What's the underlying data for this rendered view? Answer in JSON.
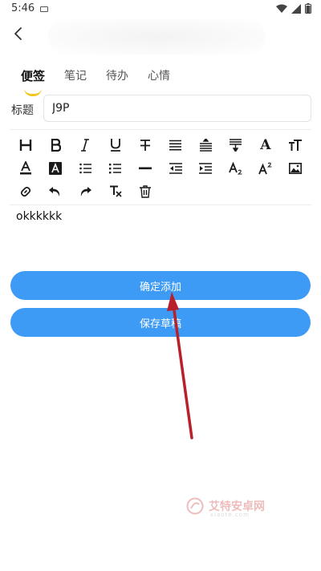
{
  "status_bar": {
    "time": "5:46"
  },
  "tabs": [
    {
      "label": "便签"
    },
    {
      "label": "笔记"
    },
    {
      "label": "待办"
    },
    {
      "label": "心情"
    }
  ],
  "form": {
    "title_label": "标题",
    "title_value": "J9P",
    "content": "okkkkkk"
  },
  "buttons": {
    "confirm_label": "确定添加",
    "draft_label": "保存草稿"
  },
  "toolbar_icons": [
    [
      "heading",
      "bold",
      "italic",
      "underline",
      "strikethrough",
      "align-justify",
      "indent-line-height",
      "move-down",
      "font",
      "text-size"
    ],
    [
      "font-color",
      "highlight",
      "ordered-list",
      "unordered-list",
      "horizontal-rule",
      "outdent",
      "indent",
      "subscript",
      "superscript",
      "image"
    ],
    [
      "link",
      "undo",
      "redo",
      "clear-format",
      "delete"
    ]
  ],
  "watermark": {
    "text": "艾特安卓网",
    "sub": "xiaote.com"
  },
  "colors": {
    "accent": "#3d9bf5",
    "tab_indicator": "#f2c81e",
    "annotation_arrow": "#c0202a"
  }
}
